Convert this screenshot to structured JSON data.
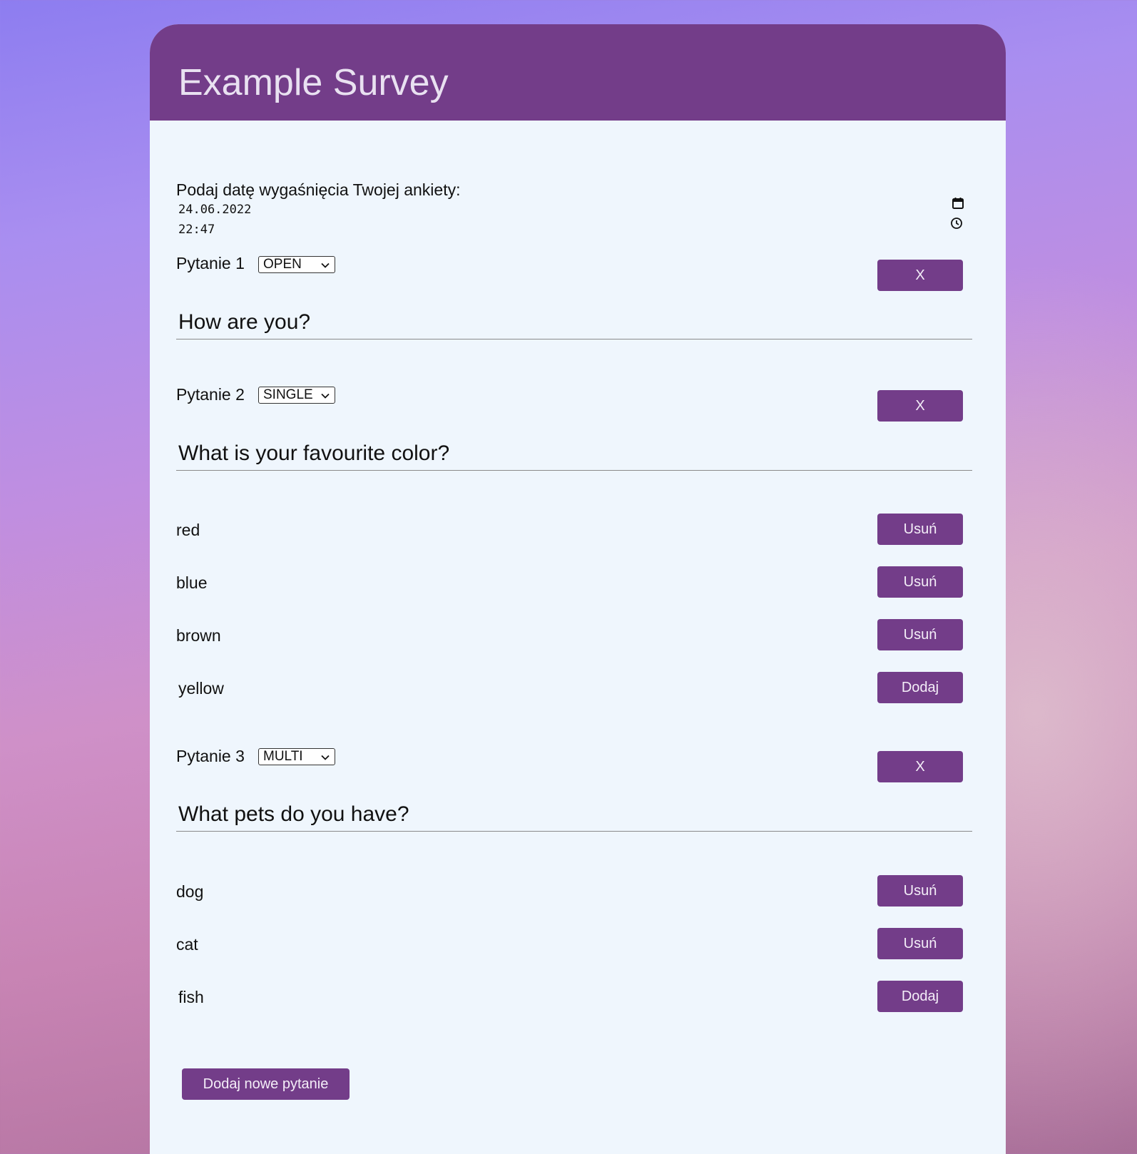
{
  "survey": {
    "title": "Example Survey"
  },
  "expiry": {
    "label": "Podaj datę wygaśnięcia Twojej ankiety:",
    "date_value": "24.06.2022",
    "time_value": "22:47",
    "date_icon": "calendar-icon",
    "time_icon": "clock-icon"
  },
  "questions": [
    {
      "label": "Pytanie 1",
      "type": "OPEN",
      "remove_label": "X",
      "text": "How are you?",
      "options": []
    },
    {
      "label": "Pytanie 2",
      "type": "SINGLE",
      "remove_label": "X",
      "text": "What is your favourite color?",
      "options": [
        {
          "text": "red",
          "button": "Usuń"
        },
        {
          "text": "blue",
          "button": "Usuń"
        },
        {
          "text": "brown",
          "button": "Usuń"
        }
      ],
      "new_option": {
        "value": "yellow",
        "button": "Dodaj"
      }
    },
    {
      "label": "Pytanie 3",
      "type": "MULTI",
      "remove_label": "X",
      "text": "What pets do you have?",
      "options": [
        {
          "text": "dog",
          "button": "Usuń"
        },
        {
          "text": "cat",
          "button": "Usuń"
        }
      ],
      "new_option": {
        "value": "fish",
        "button": "Dodaj"
      }
    }
  ],
  "add_question_label": "Dodaj nowe pytanie",
  "colors": {
    "accent": "#733d89",
    "card_background": "#eff6fd"
  }
}
